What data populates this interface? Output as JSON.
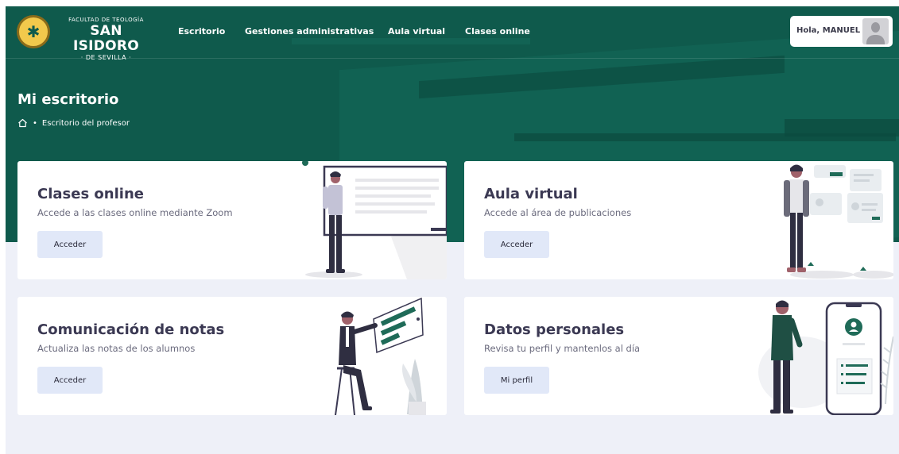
{
  "brand": {
    "line1": "FACULTAD DE TEOLOGÍA",
    "line2": "SAN ISIDORO",
    "line3": "· DE SEVILLA ·"
  },
  "nav": {
    "items": [
      {
        "label": "Escritorio"
      },
      {
        "label": "Gestiones administrativas"
      },
      {
        "label": "Aula virtual"
      },
      {
        "label": "Clases online"
      }
    ]
  },
  "user": {
    "greeting": "Hola, MANUEL",
    "avatar_icon": "user-avatar-placeholder"
  },
  "header": {
    "title": "Mi escritorio",
    "breadcrumb": {
      "home_icon": "home-icon",
      "separator": "•",
      "current": "Escritorio del profesor"
    }
  },
  "cards": [
    {
      "title": "Clases online",
      "subtitle": "Accede a las clases online mediante Zoom",
      "button": "Acceder",
      "illustration": "man-at-whiteboard"
    },
    {
      "title": "Aula virtual",
      "subtitle": "Accede al área de publicaciones",
      "button": "Acceder",
      "illustration": "man-with-floating-cards"
    },
    {
      "title": "Comunicación de notas",
      "subtitle": "Actualiza las notas de los alumnos",
      "button": "Acceder",
      "illustration": "man-on-stool-with-chart"
    },
    {
      "title": "Datos personales",
      "subtitle": "Revisa tu perfil y mantenlos al día",
      "button": "Mi perfil",
      "illustration": "man-with-phone-profile"
    }
  ],
  "colors": {
    "header_bg": "#0f5a4c",
    "page_bg": "#eef0f8",
    "button_bg": "#e1e8f8",
    "title_text": "#3b3953",
    "accent_green": "#1f6b58"
  }
}
